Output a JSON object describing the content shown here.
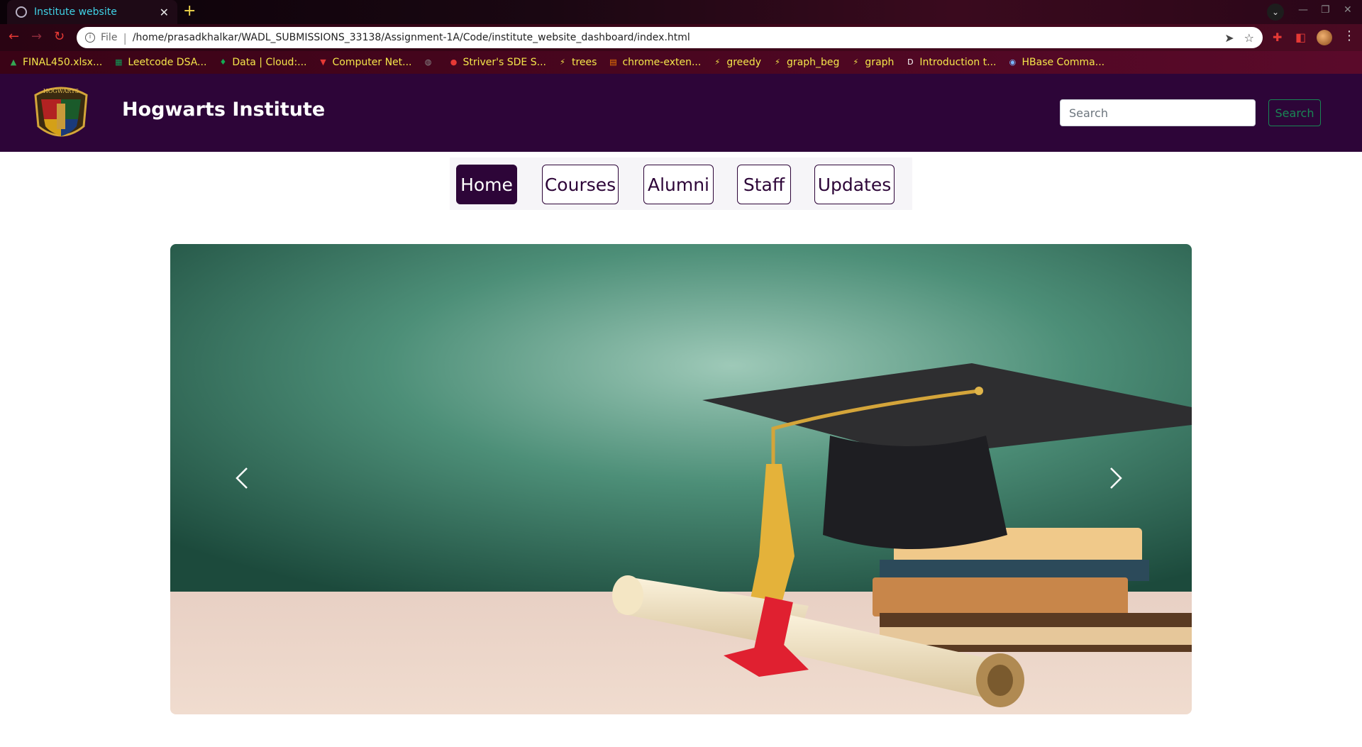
{
  "browser": {
    "tab_title": "Institute website",
    "url_scheme": "File",
    "url": "/home/prasadkhalkar/WADL_SUBMISSIONS_33138/Assignment-1A/Code/institute_website_dashboard/index.html",
    "bookmarks": [
      {
        "label": "FINAL450.xlsx...",
        "icon": "google-drive-icon",
        "color": "#34a853"
      },
      {
        "label": "Leetcode DSA...",
        "icon": "google-sheets-icon",
        "color": "#0f9d58"
      },
      {
        "label": "Data | Cloud:...",
        "icon": "leaf-icon",
        "color": "#13aa52"
      },
      {
        "label": "Computer Net...",
        "icon": "shield-v-icon",
        "color": "#e53935"
      },
      {
        "label": "",
        "icon": "globe-icon",
        "color": "#888888"
      },
      {
        "label": "Striver's SDE S...",
        "icon": "tuf-icon",
        "color": "#e53935"
      },
      {
        "label": "trees",
        "icon": "hackerrank-icon",
        "color": "#f5e64a"
      },
      {
        "label": "chrome-exten...",
        "icon": "chrome-ext-icon",
        "color": "#f57c00"
      },
      {
        "label": "greedy",
        "icon": "hackerrank-icon",
        "color": "#f5e64a"
      },
      {
        "label": "graph_beg",
        "icon": "hackerrank-icon",
        "color": "#f5e64a"
      },
      {
        "label": "graph",
        "icon": "hackerrank-icon",
        "color": "#f5e64a"
      },
      {
        "label": "Introduction t...",
        "icon": "dev-icon",
        "color": "#ffffff"
      },
      {
        "label": "HBase Comma...",
        "icon": "hbase-icon",
        "color": "#7ab8ff"
      }
    ]
  },
  "header": {
    "crest_text": "HOGWARTS",
    "title": "Hogwarts Institute",
    "search_placeholder": "Search",
    "search_button": "Search"
  },
  "nav": {
    "items": [
      "Home",
      "Courses",
      "Alumni",
      "Staff",
      "Updates"
    ],
    "active": "Home"
  },
  "carousel": {
    "image": "graduation-cap-on-books-with-diploma-scroll",
    "prev_icon": "chevron-left-icon",
    "next_icon": "chevron-right-icon"
  },
  "colors": {
    "header_bg": "#2d0538",
    "accent_green": "#198754",
    "tab_title": "#3fd2e6",
    "bookmark_text": "#f5e64a"
  }
}
